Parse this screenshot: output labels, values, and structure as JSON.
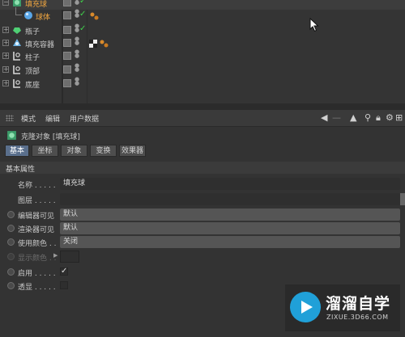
{
  "object_manager": {
    "rows": [
      {
        "name": "填充球",
        "highlight": true,
        "icon": "cloner-icon"
      },
      {
        "name": "球体",
        "highlight": true,
        "icon": "sphere-icon"
      },
      {
        "name": "瓶子",
        "highlight": false,
        "icon": "bottle-icon"
      },
      {
        "name": "填充容器",
        "highlight": false,
        "icon": "container-icon"
      },
      {
        "name": "柱子",
        "highlight": false,
        "icon": "null-object-icon"
      },
      {
        "name": "顶部",
        "highlight": false,
        "icon": "null-object-icon"
      },
      {
        "name": "底座",
        "highlight": false,
        "icon": "null-object-icon"
      }
    ]
  },
  "attribute_manager": {
    "menu": [
      "模式",
      "编辑",
      "用户数据"
    ],
    "title": "克隆对象 [填充球]",
    "tabs": [
      "基本",
      "坐标",
      "对象",
      "变换",
      "效果器"
    ],
    "active_tab": "基本",
    "section": "基本属性",
    "props": {
      "name_label": "名称 . . . . .",
      "name_value": "填充球",
      "layer_label": "图层 . . . . .",
      "editor_visible_label": "编辑器可见",
      "editor_visible_value": "默认",
      "render_visible_label": "渲染器可见",
      "render_visible_value": "默认",
      "use_color_label": "使用颜色 . .",
      "use_color_value": "关闭",
      "display_color_label": "显示颜色 . .",
      "enabled_label": "启用 . . . . .",
      "enabled_check": "✓",
      "xray_label": "透显 . . . . ."
    }
  },
  "watermark": {
    "big": "溜溜自学",
    "small": "ZIXUE.3D66.COM"
  },
  "colors": {
    "highlight_text": "#f0a640",
    "check_green": "#3fd14b",
    "active_tab": "#5a6f8c",
    "watermark_blue": "#20a0d8"
  }
}
